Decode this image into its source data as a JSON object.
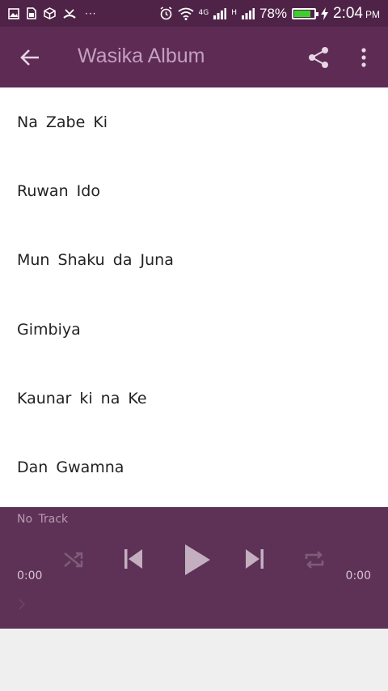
{
  "statusbar": {
    "battery_percent": "78%",
    "battery_level": 0.78,
    "time": "2:04",
    "ampm": "PM",
    "network_1": "4G",
    "network_2": "H",
    "notification_icons": [
      "image-icon",
      "sim-icon",
      "package-icon",
      "missed-call-icon"
    ],
    "more_notifications": "···"
  },
  "appbar": {
    "title": "Wasika Album",
    "background": "#5e2b55",
    "title_color": "#c39fc0"
  },
  "tracks": [
    "Na Zabe Ki",
    "Ruwan Ido",
    "Mun Shaku da Juna",
    "Gimbiya",
    "Kaunar ki na Ke",
    "Dan Gwamna"
  ],
  "player": {
    "track_name": "No Track",
    "elapsed": "0:00",
    "duration": "0:00",
    "background": "#5e3157"
  }
}
